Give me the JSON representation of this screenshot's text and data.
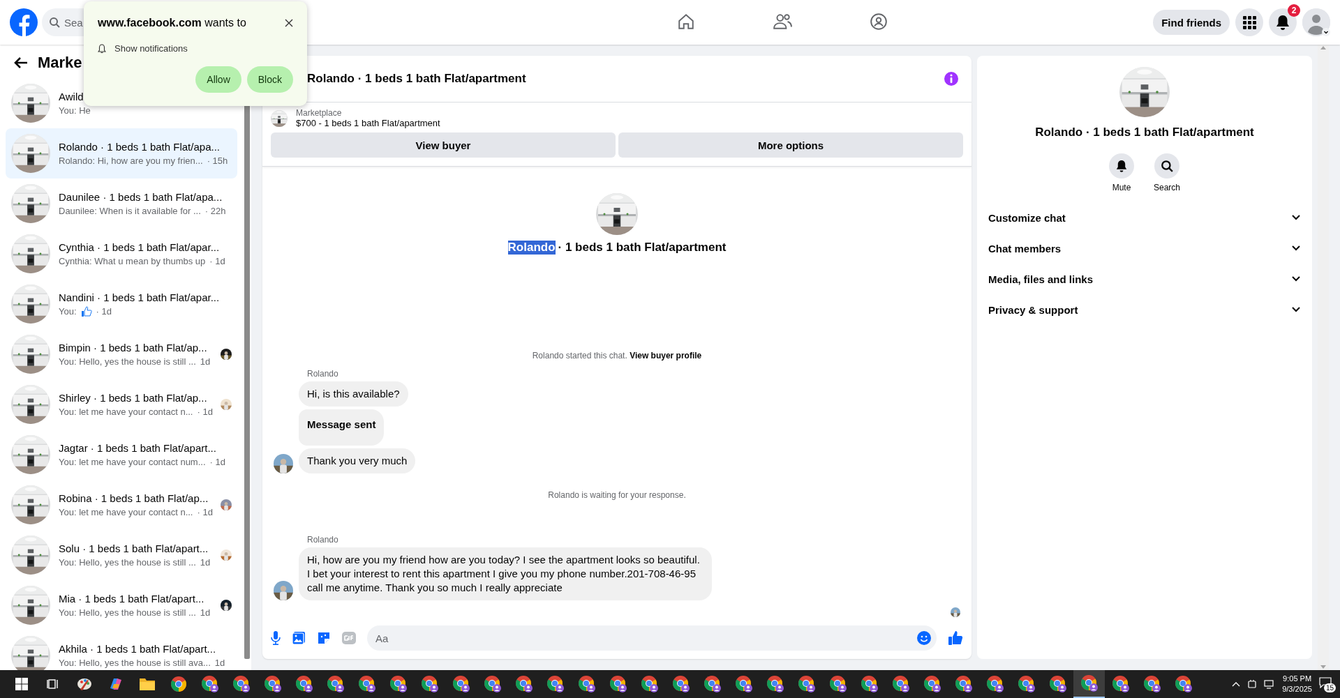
{
  "top_bar": {
    "search": {
      "placeholder": "Sea"
    },
    "nav": [
      {
        "kind": "home",
        "selected": false
      },
      {
        "kind": "friends",
        "selected": false
      },
      {
        "kind": "groups",
        "selected": false
      }
    ],
    "find_friends": "Find friends",
    "notification_count": "2"
  },
  "popup": {
    "title": "**www.facebook.com** wants to",
    "permission": "Show notifications",
    "buttons": [
      "Allow",
      "Block"
    ]
  },
  "sidebar": {
    "title": "Marke",
    "conversations": [
      {
        "name": "Awild",
        "preview": "You: He",
        "selected": false,
        "seen": false,
        "kind": "text"
      },
      {
        "name": "Rolando · 1 beds 1 bath Flat/apa...",
        "preview": "Rolando: Hi, how are you my frien...",
        "time": "· 15h",
        "selected": true,
        "seen": false,
        "kind": "text"
      },
      {
        "name": "Daunilee · 1 beds 1 bath Flat/apa...",
        "preview": "Daunilee: When is it available for ...",
        "time": "· 22h",
        "selected": false,
        "seen": false,
        "kind": "text"
      },
      {
        "name": "Cynthia · 1 beds 1 bath Flat/apar...",
        "preview": "Cynthia: What u mean by thumbs up",
        "time": "· 1d",
        "selected": false,
        "seen": false,
        "kind": "text"
      },
      {
        "name": "Nandini · 1 beds 1 bath Flat/apar...",
        "preview": "You:",
        "time": "· 1d",
        "selected": false,
        "seen": false,
        "kind": "like"
      },
      {
        "name": "Bimpin · 1 beds 1 bath Flat/ap...",
        "preview": "You: Hello, yes the house is still ...",
        "time": "1d",
        "selected": false,
        "seen": true,
        "kind": "text"
      },
      {
        "name": "Shirley · 1 beds 1 bath Flat/ap...",
        "preview": "You: let me have your contact n...",
        "time": "· 1d",
        "selected": false,
        "seen": true,
        "kind": "text"
      },
      {
        "name": "Jagtar · 1 beds 1 bath Flat/apart...",
        "preview": "You: let me have your contact num...",
        "time": "· 1d",
        "selected": false,
        "seen": false,
        "kind": "text"
      },
      {
        "name": "Robina · 1 beds 1 bath Flat/ap...",
        "preview": "You: let me have your contact n...",
        "time": "· 1d",
        "selected": false,
        "seen": true,
        "kind": "text"
      },
      {
        "name": "Solu · 1 beds 1 bath Flat/apart...",
        "preview": "You: Hello, yes the house is still ...",
        "time": "1d",
        "selected": false,
        "seen": true,
        "kind": "text"
      },
      {
        "name": "Mia · 1 beds 1 bath Flat/apart...",
        "preview": "You: Hello, yes the house is still ...",
        "time": "1d",
        "selected": false,
        "seen": true,
        "kind": "text"
      },
      {
        "name": "Akhila · 1 beds 1 bath Flat/apart...",
        "preview": "You: Hello, yes the house is still ava...",
        "time": "1d",
        "selected": false,
        "seen": false,
        "kind": "text"
      }
    ]
  },
  "chat": {
    "title": "Rolando · 1 beds 1 bath Flat/apartment",
    "listing": {
      "label": "Marketplace",
      "summary": "$700 - 1 beds 1 bath Flat/apartment"
    },
    "buttons": [
      "View buyer",
      "More options"
    ],
    "intro": {
      "highlighted": "Rolando",
      "rest": "· 1 beds 1 bath Flat/apartment"
    },
    "messages": [
      {
        "kind": "system",
        "text": "Rolando started this chat.",
        "link": "View buyer profile"
      },
      {
        "kind": "sender",
        "text": "Rolando"
      },
      {
        "kind": "bubble",
        "text": "Hi, is this available?",
        "avatar": false
      },
      {
        "kind": "notice",
        "text": "Message sent",
        "avatar": false
      },
      {
        "kind": "bubble",
        "text": "Thank you very much",
        "avatar": true
      },
      {
        "kind": "system",
        "text": "Rolando is waiting for your response."
      },
      {
        "kind": "sender",
        "text": "Rolando"
      },
      {
        "kind": "bubble",
        "text": "Hi, how are you my friend how are you today? I see the apartment looks so beautiful. I bet your interest to rent this apartment I give you my phone number.201-708-46-95 call me anytime. Thank you so much I really appreciate",
        "avatar": true
      }
    ],
    "composer": {
      "placeholder": "Aa"
    }
  },
  "details": {
    "title": "Rolando · 1 beds 1 bath Flat/apartment",
    "actions": [
      {
        "kind": "mute",
        "label": "Mute"
      },
      {
        "kind": "search",
        "label": "Search"
      }
    ],
    "sections": [
      {
        "label": "Customize chat",
        "expanded": false
      },
      {
        "label": "Chat members",
        "expanded": false
      },
      {
        "label": "Media, files and links",
        "expanded": false
      },
      {
        "label": "Privacy & support",
        "expanded": false
      }
    ]
  },
  "taskbar": {
    "apps": [
      {
        "kind": "taskview",
        "selected": false
      },
      {
        "kind": "paint",
        "selected": false
      },
      {
        "kind": "copilot",
        "selected": false
      },
      {
        "kind": "explorer",
        "selected": false
      },
      {
        "kind": "browser",
        "selected": false
      },
      {
        "kind": "profile",
        "selected": false
      },
      {
        "kind": "profile",
        "selected": false
      },
      {
        "kind": "profile",
        "selected": false
      },
      {
        "kind": "profile",
        "selected": false
      },
      {
        "kind": "profile",
        "selected": false
      },
      {
        "kind": "profile",
        "selected": false
      },
      {
        "kind": "profile",
        "selected": false
      },
      {
        "kind": "profile",
        "selected": false
      },
      {
        "kind": "profile",
        "selected": false
      },
      {
        "kind": "profile",
        "selected": false
      },
      {
        "kind": "profile",
        "selected": false
      },
      {
        "kind": "profile",
        "selected": false
      },
      {
        "kind": "profile",
        "selected": false
      },
      {
        "kind": "profile",
        "selected": false
      },
      {
        "kind": "profile",
        "selected": false
      },
      {
        "kind": "profile",
        "selected": false
      },
      {
        "kind": "profile",
        "selected": false
      },
      {
        "kind": "profile",
        "selected": false
      },
      {
        "kind": "profile",
        "selected": false
      },
      {
        "kind": "profile",
        "selected": false
      },
      {
        "kind": "profile",
        "selected": false
      },
      {
        "kind": "profile",
        "selected": false
      },
      {
        "kind": "profile",
        "selected": false
      },
      {
        "kind": "profile",
        "selected": false
      },
      {
        "kind": "profile",
        "selected": false
      },
      {
        "kind": "profile",
        "selected": false
      },
      {
        "kind": "profile",
        "selected": false
      },
      {
        "kind": "profile",
        "selected": false
      },
      {
        "kind": "profile",
        "selected": true
      },
      {
        "kind": "profile",
        "selected": false
      },
      {
        "kind": "profile",
        "selected": false
      },
      {
        "kind": "profile",
        "selected": false
      }
    ],
    "time": "9:05 PM",
    "date": "9/3/2025",
    "notification_count": "15"
  }
}
